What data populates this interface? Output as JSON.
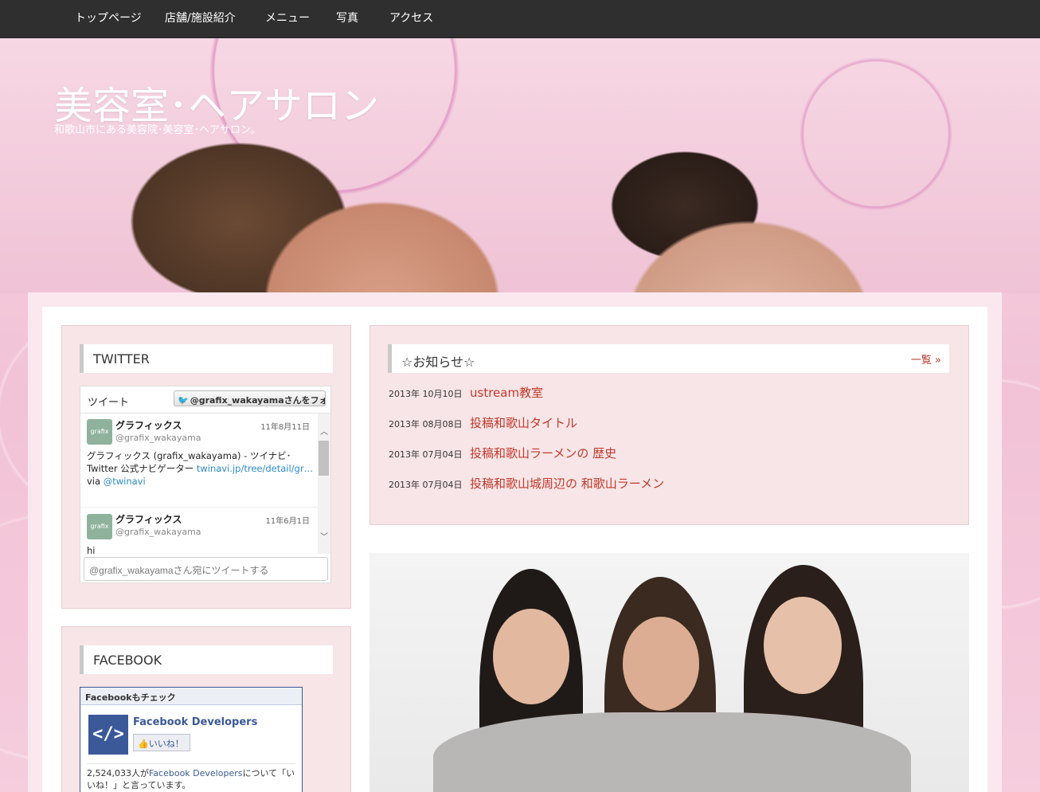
{
  "nav": {
    "items": [
      "トップページ",
      "店舗/施設紹介",
      "メニュー",
      "写真",
      "アクセス"
    ]
  },
  "header": {
    "title": "美容室･ヘアサロン",
    "description": "和歌山市にある美容院･美容室･ヘアサロン。"
  },
  "twitter": {
    "title": "TWITTER",
    "tweet_label": "ツイート",
    "follow_label": "@grafix_wakayamaさんをフォロー",
    "tweets": [
      {
        "avatar_text": "grafix",
        "name": "グラフィックス",
        "handle": "@grafix_wakayama",
        "date": "11年8月11日",
        "text": "グラフィックス (grafix_wakayama) - ツイナビ･ Twitter 公式ナビゲーター",
        "link": "twinavi.jp/tree/detail/gr…",
        "via": "via",
        "mention": "@twinavi"
      },
      {
        "avatar_text": "grafix",
        "name": "グラフィックス",
        "handle": "@grafix_wakayama",
        "date": "11年6月1日",
        "text": "hi"
      }
    ],
    "input_placeholder": "@grafix_wakayamaさん宛にツイートする"
  },
  "facebook": {
    "title": "FACEBOOK",
    "box_title": "Facebookもチェック",
    "page_name": "Facebook Developers",
    "like_label": "いいね！",
    "count_prefix": "2,524,033人が",
    "count_link": "Facebook Developers",
    "count_suffix": "について「いいね！」と言っています。"
  },
  "news": {
    "title": "☆お知らせ☆",
    "more_label": "一覧 »",
    "items": [
      {
        "date": "2013年 10月10日",
        "title": "ustream教室"
      },
      {
        "date": "2013年 08月08日",
        "title": "投稿和歌山タイトル"
      },
      {
        "date": "2013年 07月04日",
        "title": "投稿和歌山ラーメンの 歴史"
      },
      {
        "date": "2013年 07月04日",
        "title": "投稿和歌山城周辺の 和歌山ラーメン"
      }
    ]
  },
  "colors": {
    "nav_bg": "#2f2f2f",
    "link_red": "#c0392b",
    "widget_bg": "#f8e5e7",
    "facebook_blue": "#3b5998",
    "twitter_blue": "#2aa3ef"
  },
  "icons": {
    "twitter_bird": "twitter-bird-icon",
    "facebook_logo": "facebook-developers-logo-icon",
    "like_thumb": "thumbs-up-icon",
    "scroll_up": "scroll-up-arrow-icon",
    "scroll_down": "scroll-down-arrow-icon"
  }
}
